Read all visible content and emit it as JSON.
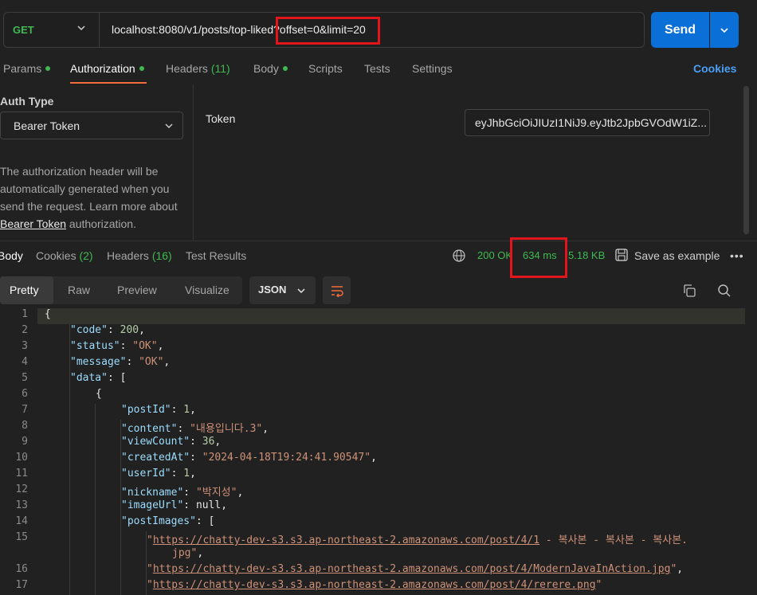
{
  "request": {
    "method": "GET",
    "url": "localhost:8080/v1/posts/top-liked?offset=0&limit=20",
    "send_label": "Send"
  },
  "request_tabs": {
    "params": "Params",
    "authorization": "Authorization",
    "headers": "Headers",
    "headers_count": "(11)",
    "body": "Body",
    "scripts": "Scripts",
    "tests": "Tests",
    "settings": "Settings",
    "cookies": "Cookies"
  },
  "auth": {
    "type_label": "Auth Type",
    "type_value": "Bearer Token",
    "desc_1": "The authorization header will be automatically generated when you send the request. Learn more about ",
    "desc_link": "Bearer Token",
    "desc_2": " authorization.",
    "token_label": "Token",
    "token_value": "eyJhbGciOiJIUzI1NiJ9.eyJtb2JpbGVOdW1iZ..."
  },
  "response_tabs": {
    "body": "Body",
    "cookies": "Cookies",
    "cookies_count": "(2)",
    "headers": "Headers",
    "headers_count": "(16)",
    "test_results": "Test Results"
  },
  "response_status": {
    "status": "200 OK",
    "time": "634 ms",
    "size": "5.18 KB",
    "save_label": "Save as example",
    "more": "•••"
  },
  "body_view": {
    "tabs": [
      "Pretty",
      "Raw",
      "Preview",
      "Visualize"
    ],
    "format": "JSON"
  },
  "code_lines": [
    "{",
    "\"code\": 200,",
    "\"status\": \"OK\",",
    "\"message\": \"OK\",",
    "\"data\": [",
    "{",
    "\"postId\": 1,",
    "\"content\": \"내용입니다.3\",",
    "\"viewCount\": 36,",
    "\"createdAt\": \"2024-04-18T19:24:41.90547\",",
    "\"userId\": 1,",
    "\"nickname\": \"박지성\",",
    "\"imageUrl\": null,",
    "\"postImages\": [",
    "\"https://chatty-dev-s3.s3.ap-northeast-2.amazonaws.com/post/4/1 - 복사본 - 복사본 - 복사본.jpg\",",
    "\"https://chatty-dev-s3.s3.ap-northeast-2.amazonaws.com/post/4/ModernJavaInAction.jpg\",",
    "\"https://chatty-dev-s3.s3.ap-northeast-2.amazonaws.com/post/4/rerere.png\""
  ],
  "json": {
    "k_code": "\"code\"",
    "v_code": "200",
    "k_status": "\"status\"",
    "v_status": "\"OK\"",
    "k_message": "\"message\"",
    "v_message": "\"OK\"",
    "k_data": "\"data\"",
    "k_postId": "\"postId\"",
    "v_postId": "1",
    "k_content": "\"content\"",
    "v_content": "\"내용입니다.3\"",
    "k_viewCount": "\"viewCount\"",
    "v_viewCount": "36",
    "k_createdAt": "\"createdAt\"",
    "v_createdAt": "\"2024-04-18T19:24:41.90547\"",
    "k_userId": "\"userId\"",
    "v_userId": "1",
    "k_nickname": "\"nickname\"",
    "v_nickname": "\"박지성\"",
    "k_imageUrl": "\"imageUrl\"",
    "v_imageUrl": "null",
    "k_postImages": "\"postImages\"",
    "img1_url": "https://chatty-dev-s3.s3.ap-northeast-2.amazonaws.com/post/4/1",
    "img1_rest": " - 복사본 - 복사본 - 복사본.",
    "img1_ext": "jpg",
    "img2_url": "https://chatty-dev-s3.s3.ap-northeast-2.amazonaws.com/post/4/ModernJavaInAction.jpg",
    "img3_url": "https://chatty-dev-s3.s3.ap-northeast-2.amazonaws.com/post/4/rerere.png"
  },
  "line_numbers": [
    "1",
    "2",
    "3",
    "4",
    "5",
    "6",
    "7",
    "8",
    "9",
    "10",
    "11",
    "12",
    "13",
    "14",
    "15",
    "16",
    "17"
  ],
  "colors": {
    "accent": "#0a6fd6",
    "success": "#3fb950",
    "highlight": "#e2141c",
    "tab_underline": "#f26b3a"
  },
  "icons": [
    "chevron-down-icon",
    "globe-icon",
    "save-icon",
    "more-icon",
    "wrap-icon",
    "copy-icon",
    "search-icon"
  ]
}
